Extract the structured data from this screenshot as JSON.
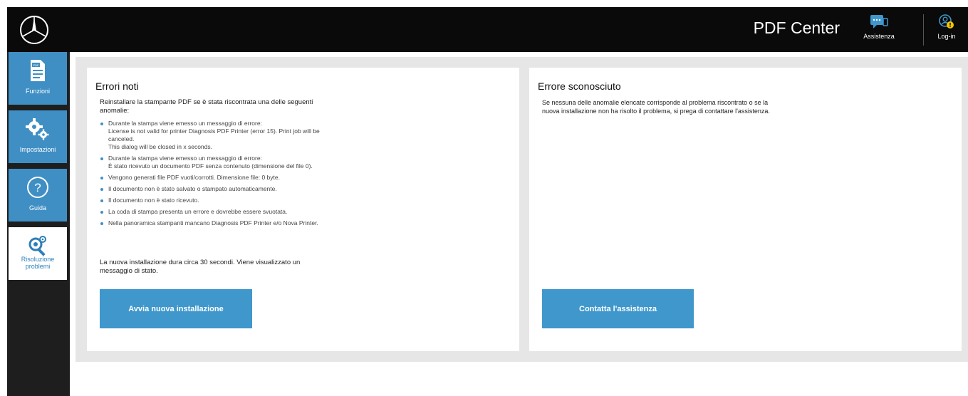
{
  "header": {
    "app_title": "PDF Center",
    "support_label": "Assistenza",
    "login_label": "Log-in"
  },
  "sidebar": {
    "items": [
      {
        "label": "Funzioni",
        "icon": "pdf-document-icon"
      },
      {
        "label": "Impostazioni",
        "icon": "gears-icon"
      },
      {
        "label": "Guida",
        "icon": "help-icon"
      },
      {
        "label": "Risoluzione problemi",
        "icon": "troubleshoot-icon"
      }
    ]
  },
  "known_errors": {
    "title": "Errori noti",
    "intro": "Reinstallare la stampante PDF se è stata riscontrata una delle seguenti anomalie:",
    "items": [
      {
        "main": "Durante la stampa viene emesso un messaggio di errore:",
        "detail": "License is not valid for printer Diagnosis PDF Printer (error 15). Print job will be canceled.",
        "detail2": "This dialog will be closed in x seconds."
      },
      {
        "main": "Durante la stampa viene emesso un messaggio di errore:",
        "detail": "È stato ricevuto un documento PDF senza contenuto (dimensione del file 0).",
        "detail2": ""
      },
      {
        "main": "Vengono generati file PDF vuoti/corrotti. Dimensione file: 0 byte."
      },
      {
        "main": "Il documento non è stato salvato o stampato automaticamente."
      },
      {
        "main": "Il documento non è stato ricevuto."
      },
      {
        "main": "La coda di stampa presenta un errore e dovrebbe essere svuotata."
      },
      {
        "main": "Nella panoramica stampanti mancano Diagnosis PDF Printer e/o Nova Printer."
      }
    ],
    "note": "La nuova installazione dura circa 30 secondi. Viene visualizzato un messaggio di stato.",
    "button_label": "Avvia nuova installazione"
  },
  "unknown_error": {
    "title": "Errore sconosciuto",
    "text": "Se nessuna delle anomalie elencate corrisponde al problema riscontrato o se la nuova installazione non ha risolto il problema, si prega di contattare l'assistenza.",
    "button_label": "Contatta l'assistenza"
  },
  "colors": {
    "accent": "#3f97cc",
    "topbar": "#0a0a0a",
    "sidebar": "#1e1e1e",
    "content_bg": "#e6e6e6"
  }
}
